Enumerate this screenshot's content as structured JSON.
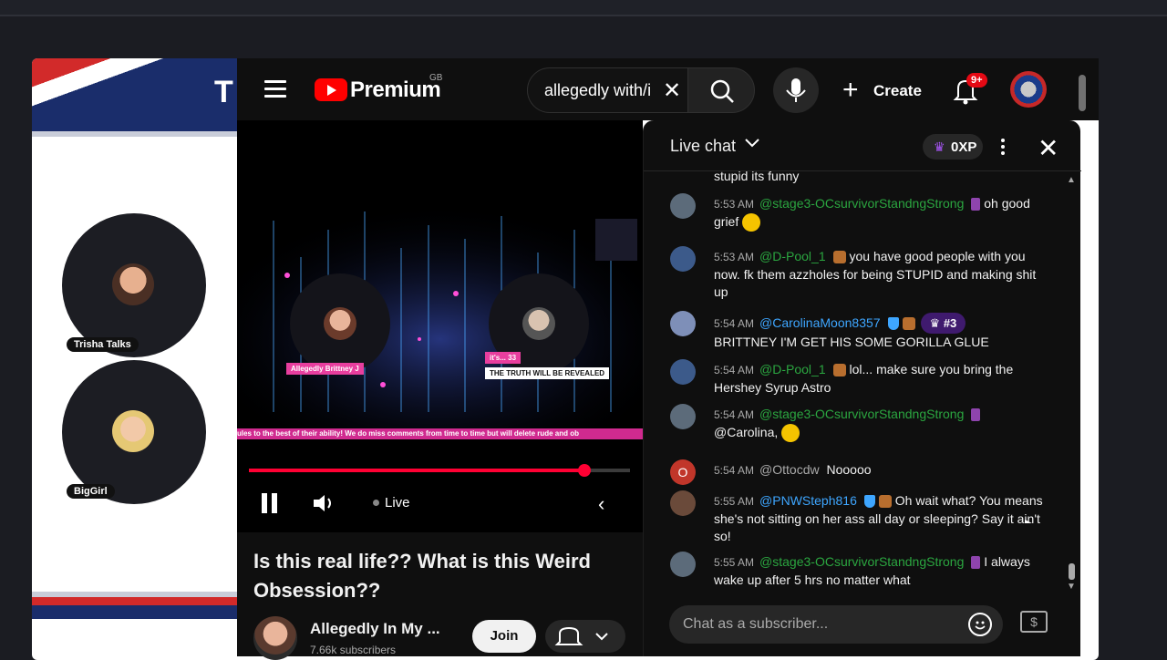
{
  "stream_overlay": {
    "logo_fragment": "T",
    "guests": [
      {
        "label": "Trisha Talks"
      },
      {
        "label": "BigGirl"
      }
    ]
  },
  "header": {
    "brand": "Premium",
    "region": "GB",
    "search_value": "allegedly with/i",
    "create_label": "Create",
    "notifications_badge": "9+"
  },
  "player": {
    "status": "Live",
    "progress_fraction": 0.88,
    "ticker_text": "ules to the best of their ability! We do miss comments from time to time but will delete rude and ob",
    "left_tag": "Allegedly Brittney J",
    "right_tag": "it's... 33",
    "right_subtag": "THE TRUTH WILL BE REVEALED"
  },
  "video": {
    "title": "Is this real life?? What is this Weird Obsession??",
    "channel_name": "Allegedly In My ...",
    "subscribers": "7.66k subscribers",
    "join_label": "Join"
  },
  "chat": {
    "title": "Live chat",
    "xp": "0XP",
    "partial_top": "stupid its funny",
    "messages": [
      {
        "time": "5:53 AM",
        "author": "@stage3-OCsurvivorStandngStrong",
        "text": "oh good grief",
        "author_color": "green"
      },
      {
        "time": "5:53 AM",
        "author": "@D-Pool_1",
        "text": "you have good people with you now. fk them azzholes for being STUPID and making shit up",
        "author_color": "green"
      },
      {
        "time": "5:54 AM",
        "author": "@CarolinaMoon8357",
        "rank": "#3",
        "text": "BRITTNEY I'M GET HIS SOME GORILLA GLUE",
        "author_color": "blue"
      },
      {
        "time": "5:54 AM",
        "author": "@D-Pool_1",
        "text": "lol... make sure you bring the Hershey Syrup Astro",
        "author_color": "green"
      },
      {
        "time": "5:54 AM",
        "author": "@stage3-OCsurvivorStandngStrong",
        "text": "@Carolina,",
        "author_color": "green"
      },
      {
        "time": "5:54 AM",
        "author": "@Ottocdw",
        "text": "Nooooo",
        "author_color": "grey",
        "avatar_letter": "O"
      },
      {
        "time": "5:55 AM",
        "author": "@PNWSteph816",
        "text": "Oh wait what? You means she's not sitting on her ass all day or sleeping? Say it ain't so!",
        "author_color": "blue"
      },
      {
        "time": "5:55 AM",
        "author": "@stage3-OCsurvivorStandngStrong",
        "text": "I always wake up after 5 hrs no matter what",
        "author_color": "green"
      }
    ],
    "input_placeholder": "Chat as a subscriber..."
  }
}
